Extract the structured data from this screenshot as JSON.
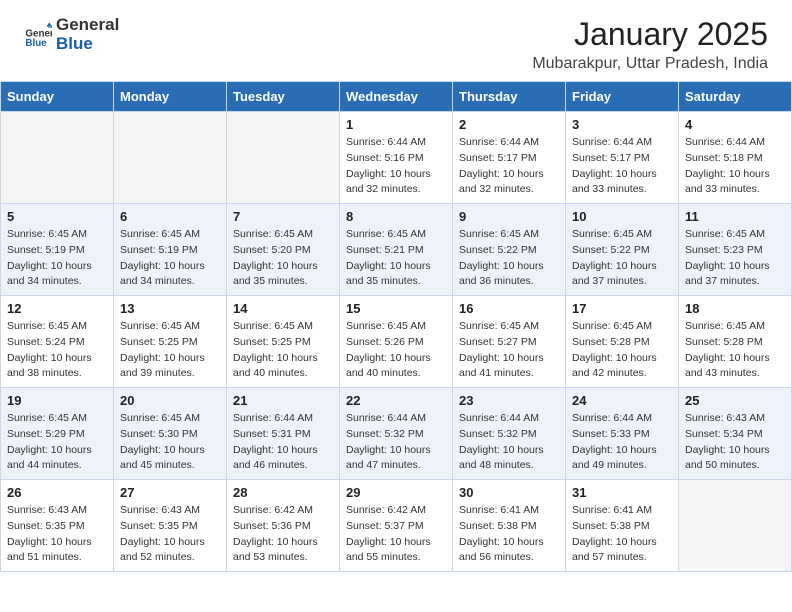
{
  "header": {
    "logo_general": "General",
    "logo_blue": "Blue",
    "month": "January 2025",
    "location": "Mubarakpur, Uttar Pradesh, India"
  },
  "days_of_week": [
    "Sunday",
    "Monday",
    "Tuesday",
    "Wednesday",
    "Thursday",
    "Friday",
    "Saturday"
  ],
  "weeks": [
    [
      {
        "day": "",
        "info": ""
      },
      {
        "day": "",
        "info": ""
      },
      {
        "day": "",
        "info": ""
      },
      {
        "day": "1",
        "info": "Sunrise: 6:44 AM\nSunset: 5:16 PM\nDaylight: 10 hours\nand 32 minutes."
      },
      {
        "day": "2",
        "info": "Sunrise: 6:44 AM\nSunset: 5:17 PM\nDaylight: 10 hours\nand 32 minutes."
      },
      {
        "day": "3",
        "info": "Sunrise: 6:44 AM\nSunset: 5:17 PM\nDaylight: 10 hours\nand 33 minutes."
      },
      {
        "day": "4",
        "info": "Sunrise: 6:44 AM\nSunset: 5:18 PM\nDaylight: 10 hours\nand 33 minutes."
      }
    ],
    [
      {
        "day": "5",
        "info": "Sunrise: 6:45 AM\nSunset: 5:19 PM\nDaylight: 10 hours\nand 34 minutes."
      },
      {
        "day": "6",
        "info": "Sunrise: 6:45 AM\nSunset: 5:19 PM\nDaylight: 10 hours\nand 34 minutes."
      },
      {
        "day": "7",
        "info": "Sunrise: 6:45 AM\nSunset: 5:20 PM\nDaylight: 10 hours\nand 35 minutes."
      },
      {
        "day": "8",
        "info": "Sunrise: 6:45 AM\nSunset: 5:21 PM\nDaylight: 10 hours\nand 35 minutes."
      },
      {
        "day": "9",
        "info": "Sunrise: 6:45 AM\nSunset: 5:22 PM\nDaylight: 10 hours\nand 36 minutes."
      },
      {
        "day": "10",
        "info": "Sunrise: 6:45 AM\nSunset: 5:22 PM\nDaylight: 10 hours\nand 37 minutes."
      },
      {
        "day": "11",
        "info": "Sunrise: 6:45 AM\nSunset: 5:23 PM\nDaylight: 10 hours\nand 37 minutes."
      }
    ],
    [
      {
        "day": "12",
        "info": "Sunrise: 6:45 AM\nSunset: 5:24 PM\nDaylight: 10 hours\nand 38 minutes."
      },
      {
        "day": "13",
        "info": "Sunrise: 6:45 AM\nSunset: 5:25 PM\nDaylight: 10 hours\nand 39 minutes."
      },
      {
        "day": "14",
        "info": "Sunrise: 6:45 AM\nSunset: 5:25 PM\nDaylight: 10 hours\nand 40 minutes."
      },
      {
        "day": "15",
        "info": "Sunrise: 6:45 AM\nSunset: 5:26 PM\nDaylight: 10 hours\nand 40 minutes."
      },
      {
        "day": "16",
        "info": "Sunrise: 6:45 AM\nSunset: 5:27 PM\nDaylight: 10 hours\nand 41 minutes."
      },
      {
        "day": "17",
        "info": "Sunrise: 6:45 AM\nSunset: 5:28 PM\nDaylight: 10 hours\nand 42 minutes."
      },
      {
        "day": "18",
        "info": "Sunrise: 6:45 AM\nSunset: 5:28 PM\nDaylight: 10 hours\nand 43 minutes."
      }
    ],
    [
      {
        "day": "19",
        "info": "Sunrise: 6:45 AM\nSunset: 5:29 PM\nDaylight: 10 hours\nand 44 minutes."
      },
      {
        "day": "20",
        "info": "Sunrise: 6:45 AM\nSunset: 5:30 PM\nDaylight: 10 hours\nand 45 minutes."
      },
      {
        "day": "21",
        "info": "Sunrise: 6:44 AM\nSunset: 5:31 PM\nDaylight: 10 hours\nand 46 minutes."
      },
      {
        "day": "22",
        "info": "Sunrise: 6:44 AM\nSunset: 5:32 PM\nDaylight: 10 hours\nand 47 minutes."
      },
      {
        "day": "23",
        "info": "Sunrise: 6:44 AM\nSunset: 5:32 PM\nDaylight: 10 hours\nand 48 minutes."
      },
      {
        "day": "24",
        "info": "Sunrise: 6:44 AM\nSunset: 5:33 PM\nDaylight: 10 hours\nand 49 minutes."
      },
      {
        "day": "25",
        "info": "Sunrise: 6:43 AM\nSunset: 5:34 PM\nDaylight: 10 hours\nand 50 minutes."
      }
    ],
    [
      {
        "day": "26",
        "info": "Sunrise: 6:43 AM\nSunset: 5:35 PM\nDaylight: 10 hours\nand 51 minutes."
      },
      {
        "day": "27",
        "info": "Sunrise: 6:43 AM\nSunset: 5:35 PM\nDaylight: 10 hours\nand 52 minutes."
      },
      {
        "day": "28",
        "info": "Sunrise: 6:42 AM\nSunset: 5:36 PM\nDaylight: 10 hours\nand 53 minutes."
      },
      {
        "day": "29",
        "info": "Sunrise: 6:42 AM\nSunset: 5:37 PM\nDaylight: 10 hours\nand 55 minutes."
      },
      {
        "day": "30",
        "info": "Sunrise: 6:41 AM\nSunset: 5:38 PM\nDaylight: 10 hours\nand 56 minutes."
      },
      {
        "day": "31",
        "info": "Sunrise: 6:41 AM\nSunset: 5:38 PM\nDaylight: 10 hours\nand 57 minutes."
      },
      {
        "day": "",
        "info": ""
      }
    ]
  ]
}
